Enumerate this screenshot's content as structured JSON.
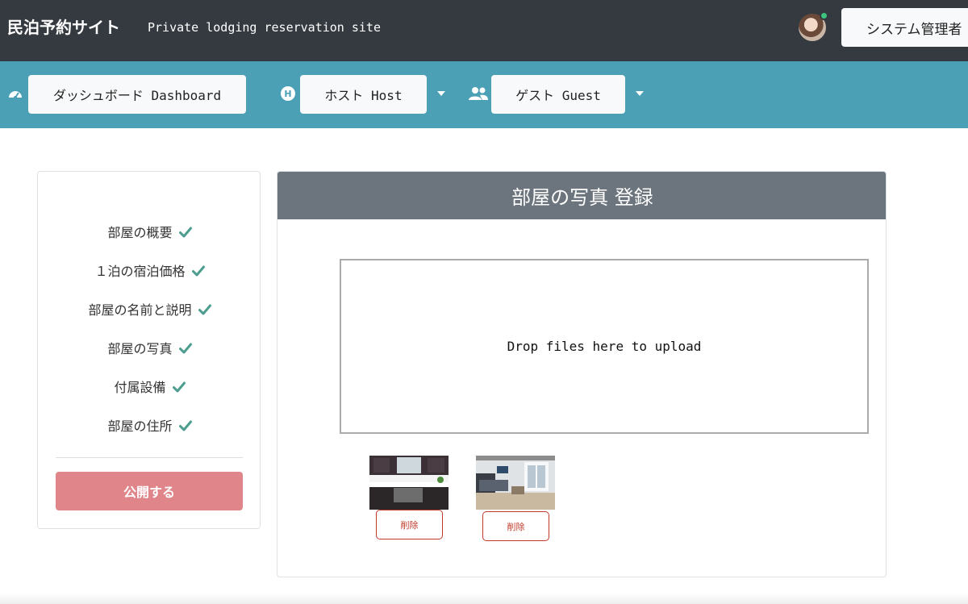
{
  "header": {
    "site_title": "民泊予約サイト",
    "site_subtitle": "Private lodging reservation site",
    "user_button": "システム管理者"
  },
  "nav": {
    "dashboard": "ダッシュボード Dashboard",
    "host": "ホスト Host",
    "guest": "ゲスト Guest",
    "host_badge": "H"
  },
  "steps": [
    {
      "label": "部屋の概要",
      "done": true
    },
    {
      "label": "１泊の宿泊価格",
      "done": true
    },
    {
      "label": "部屋の名前と説明",
      "done": true
    },
    {
      "label": "部屋の写真",
      "done": true
    },
    {
      "label": "付属設備",
      "done": true
    },
    {
      "label": "部屋の住所",
      "done": true
    }
  ],
  "publish_button": "公開する",
  "main": {
    "title": "部屋の写真 登録",
    "dropzone_text": "Drop files here to upload",
    "photos": [
      {
        "delete_label": "削除"
      },
      {
        "delete_label": "削除"
      }
    ]
  },
  "colors": {
    "topbar": "#343a40",
    "navbar": "#4ba0b6",
    "check": "#4a9d8f",
    "publish": "#e0868b",
    "card_header": "#6c757d",
    "delete": "#c0392b"
  }
}
